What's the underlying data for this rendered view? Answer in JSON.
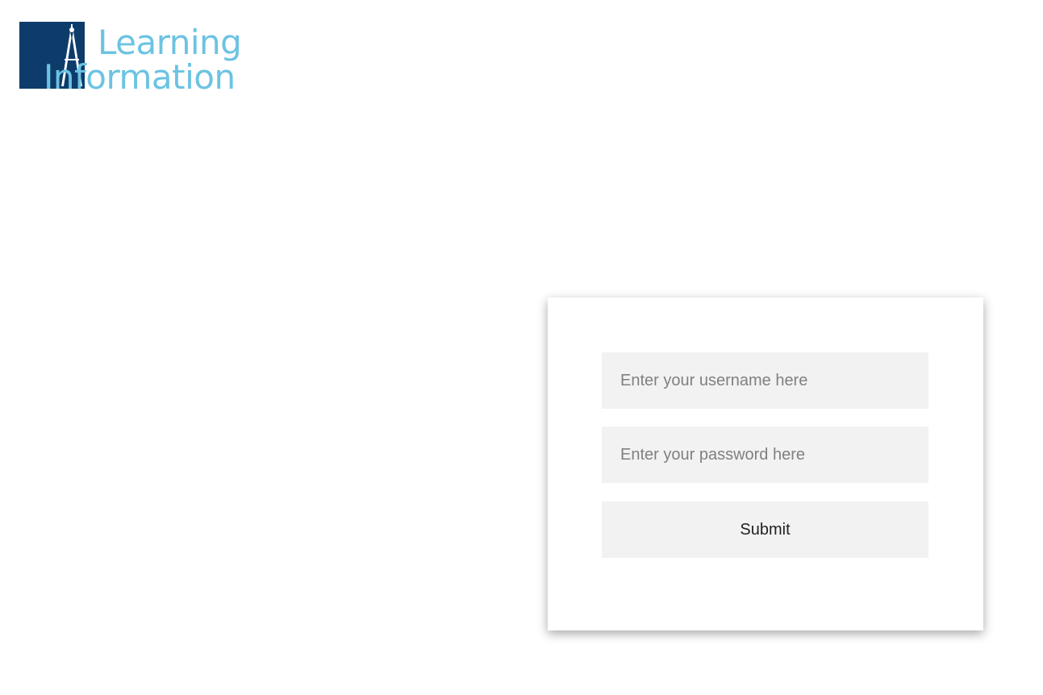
{
  "logo": {
    "line1": "Learning",
    "line2": "Information",
    "square_color": "#0d3c6b",
    "text_color": "#6cc3e2",
    "icon": "compass-icon"
  },
  "login": {
    "username_placeholder": "Enter your username here",
    "password_placeholder": "Enter your password here",
    "username_value": "",
    "password_value": "",
    "submit_label": "Submit"
  }
}
